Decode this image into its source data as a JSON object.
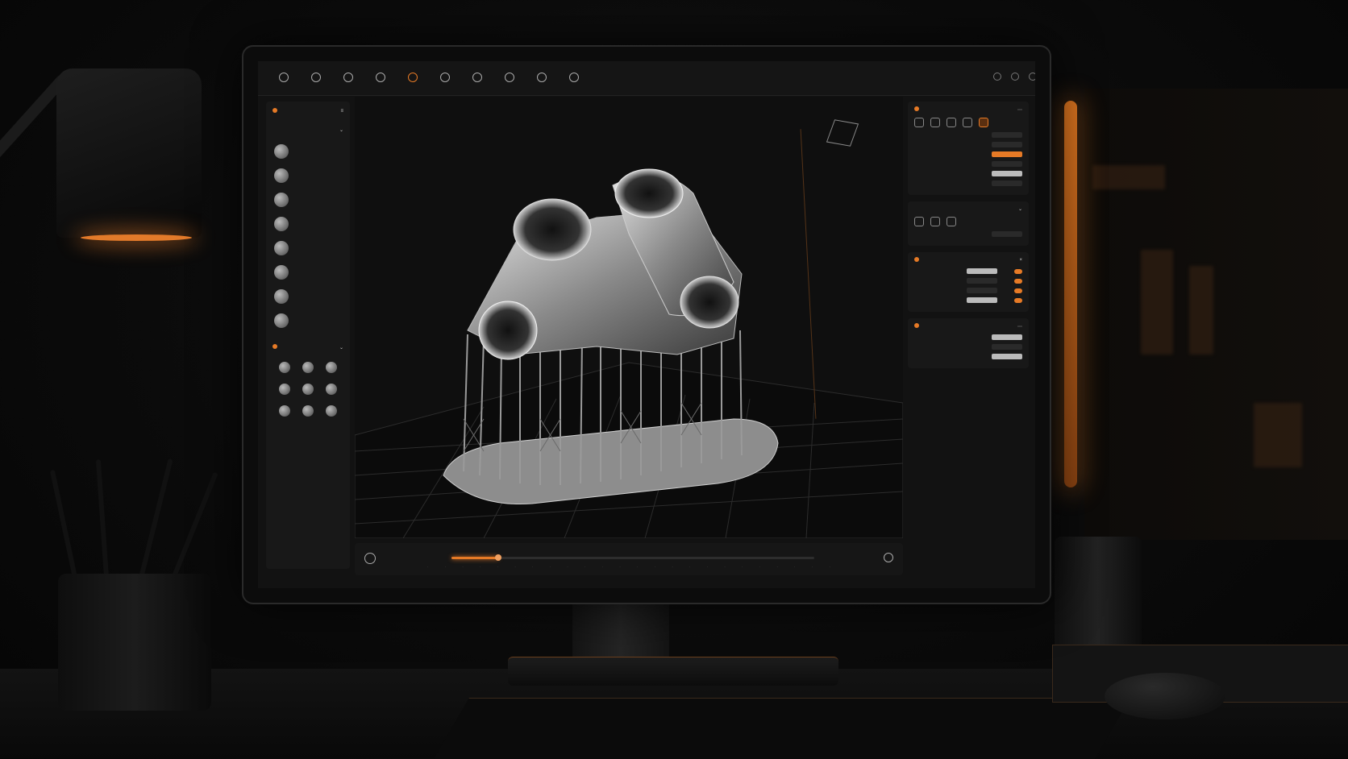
{
  "colors": {
    "accent": "#e67a26",
    "panel": "#181818",
    "viewport": "#0f0f0f"
  },
  "toolbar": {
    "tools": [
      {
        "icon": "home-icon",
        "label": ""
      },
      {
        "icon": "layers-icon",
        "label": ""
      },
      {
        "icon": "move-icon",
        "label": ""
      },
      {
        "icon": "rotate-icon",
        "label": ""
      },
      {
        "icon": "support-icon",
        "label": ""
      },
      {
        "icon": "orient-icon",
        "label": ""
      },
      {
        "icon": "slice-icon",
        "label": ""
      },
      {
        "icon": "measure-icon",
        "label": ""
      },
      {
        "icon": "settings-icon",
        "label": ""
      },
      {
        "icon": "preview-icon",
        "label": ""
      }
    ],
    "active_index": 4,
    "brand_label": ""
  },
  "left_panel": {
    "title": "",
    "section_title": "",
    "models": [
      {
        "label": ""
      },
      {
        "label": ""
      },
      {
        "label": ""
      },
      {
        "label": ""
      },
      {
        "label": ""
      },
      {
        "label": ""
      },
      {
        "label": ""
      },
      {
        "label": ""
      }
    ],
    "library_title": "",
    "library": [
      {
        "label": ""
      },
      {
        "label": ""
      },
      {
        "label": ""
      },
      {
        "label": ""
      },
      {
        "label": ""
      },
      {
        "label": ""
      },
      {
        "label": ""
      },
      {
        "label": ""
      },
      {
        "label": ""
      }
    ]
  },
  "right_panel": {
    "panel1_title": "",
    "panel2_title": "",
    "panel3_title": "",
    "panel4_title": ""
  },
  "timeline": {
    "name": "",
    "label": "",
    "progress": 0.13
  }
}
